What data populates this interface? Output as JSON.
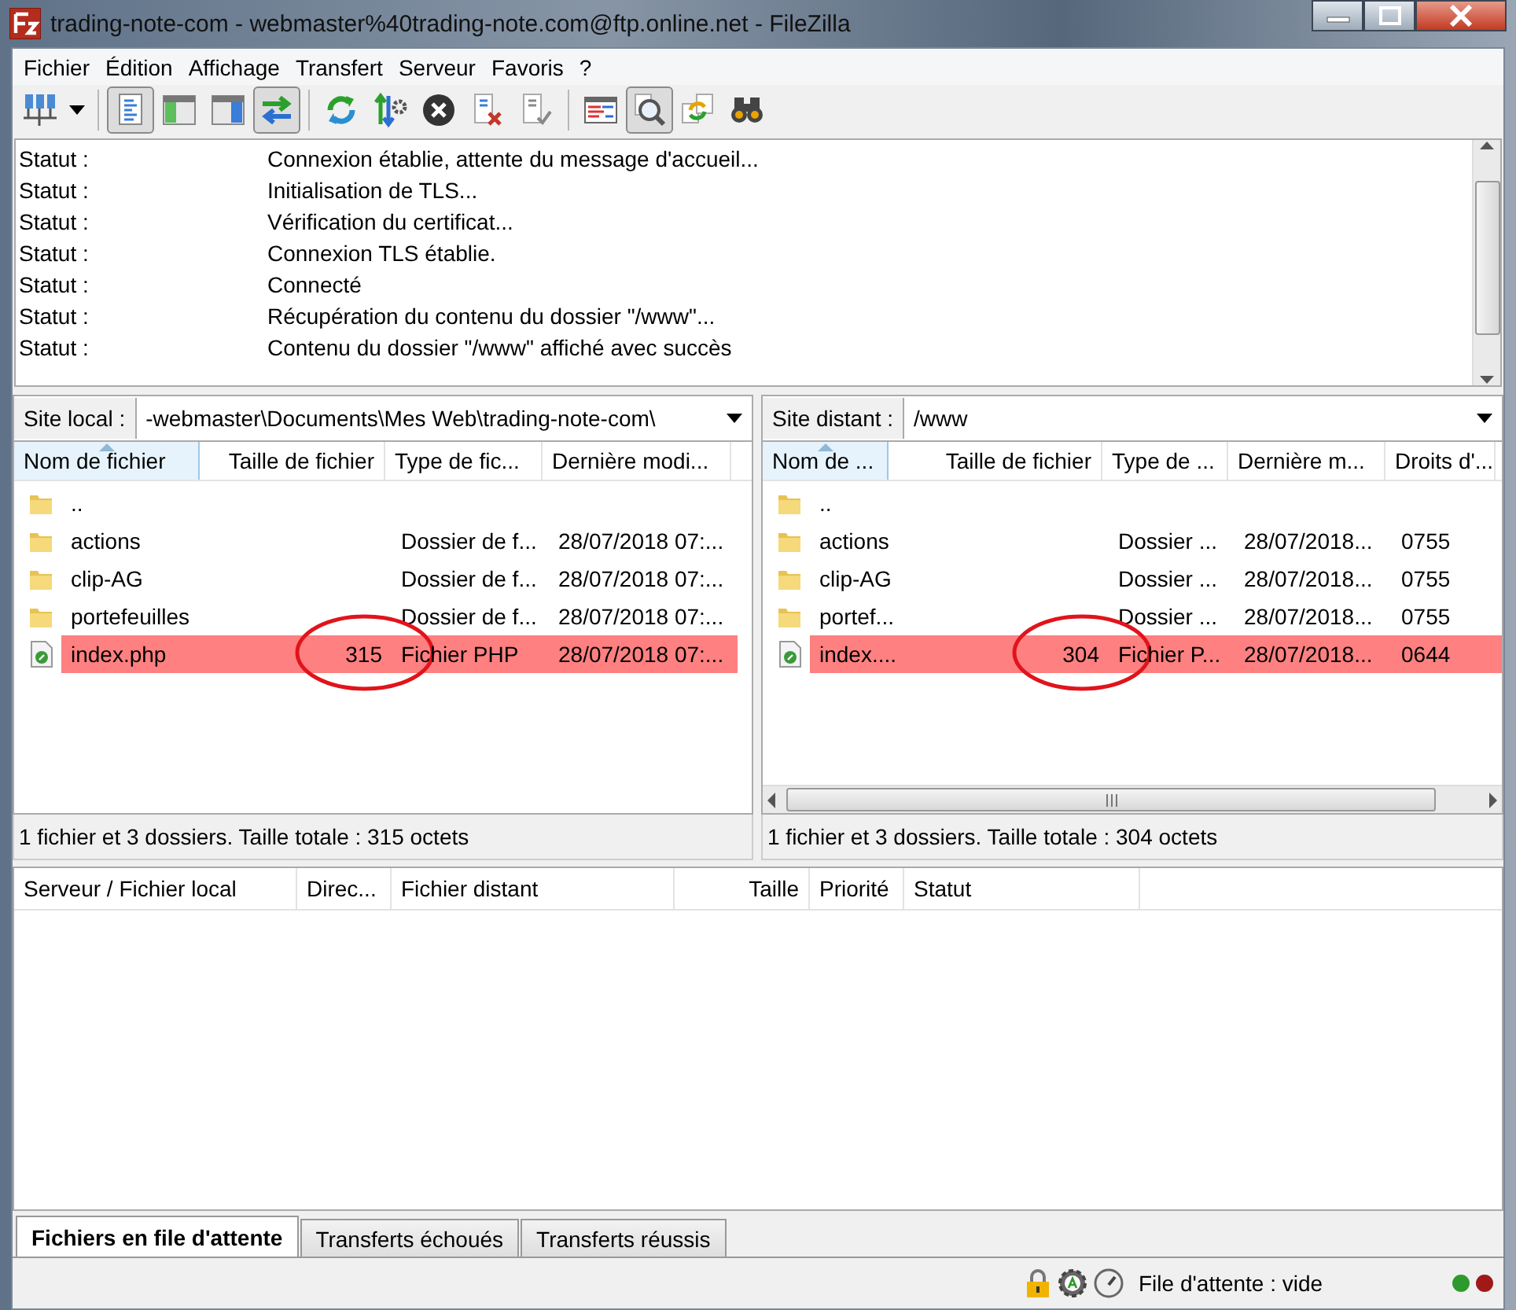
{
  "window": {
    "title": "trading-note-com - webmaster%40trading-note.com@ftp.online.net - FileZilla"
  },
  "menu": [
    "Fichier",
    "Édition",
    "Affichage",
    "Transfert",
    "Serveur",
    "Favoris",
    "?"
  ],
  "toolbar": [
    {
      "buttons": [
        {
          "kind": "servers",
          "pressed": false
        },
        {
          "kind": "caret",
          "pressed": false
        }
      ]
    },
    {
      "buttons": [
        {
          "kind": "document",
          "pressed": true
        },
        {
          "kind": "window-green",
          "pressed": false
        },
        {
          "kind": "window-blue",
          "pressed": false
        },
        {
          "kind": "arrows",
          "pressed": true
        }
      ]
    },
    {
      "buttons": [
        {
          "kind": "refresh",
          "pressed": false
        },
        {
          "kind": "updown-gear",
          "pressed": false
        },
        {
          "kind": "cancel",
          "pressed": false
        },
        {
          "kind": "file-x",
          "pressed": false
        },
        {
          "kind": "file-check",
          "pressed": false
        }
      ]
    },
    {
      "buttons": [
        {
          "kind": "table",
          "pressed": false
        },
        {
          "kind": "magnifier",
          "pressed": true
        },
        {
          "kind": "sync",
          "pressed": false
        },
        {
          "kind": "binoculars",
          "pressed": false
        }
      ]
    }
  ],
  "log": [
    {
      "label": "Statut :",
      "message": "Connexion établie, attente du message d'accueil..."
    },
    {
      "label": "Statut :",
      "message": "Initialisation de TLS..."
    },
    {
      "label": "Statut :",
      "message": "Vérification du certificat..."
    },
    {
      "label": "Statut :",
      "message": "Connexion TLS établie."
    },
    {
      "label": "Statut :",
      "message": "Connecté"
    },
    {
      "label": "Statut :",
      "message": "Récupération du contenu du dossier \"/www\"..."
    },
    {
      "label": "Statut :",
      "message": "Contenu du dossier \"/www\" affiché avec succès"
    }
  ],
  "panes": [
    {
      "label": "Site local :",
      "path": "-webmaster\\Documents\\Mes Web\\trading-note-com\\",
      "columns": [
        {
          "label": "Nom de fichier",
          "sorted": true
        },
        {
          "label": "Taille de fichier",
          "sorted": false
        },
        {
          "label": "Type de fic...",
          "sorted": false
        },
        {
          "label": "Dernière modi...",
          "sorted": false
        }
      ],
      "rows": [
        {
          "kind": "folder",
          "highlighted": false,
          "circled": false,
          "cells": [
            ".."
          ]
        },
        {
          "kind": "folder",
          "highlighted": false,
          "circled": false,
          "cells": [
            "actions",
            "",
            "Dossier de f...",
            "28/07/2018 07:..."
          ]
        },
        {
          "kind": "folder",
          "highlighted": false,
          "circled": false,
          "cells": [
            "clip-AG",
            "",
            "Dossier de f...",
            "28/07/2018 07:..."
          ]
        },
        {
          "kind": "folder",
          "highlighted": false,
          "circled": false,
          "cells": [
            "portefeuilles",
            "",
            "Dossier de f...",
            "28/07/2018 07:..."
          ]
        },
        {
          "kind": "php",
          "highlighted": true,
          "circled": true,
          "cells": [
            "index.php",
            "315",
            "Fichier PHP",
            "28/07/2018 07:..."
          ]
        }
      ],
      "hscroll": false,
      "summary": "1 fichier et 3 dossiers. Taille totale : 315 octets"
    },
    {
      "label": "Site distant :",
      "path": "/www",
      "columns": [
        {
          "label": "Nom de ...",
          "sorted": true
        },
        {
          "label": "Taille de fichier",
          "sorted": false
        },
        {
          "label": "Type de ...",
          "sorted": false
        },
        {
          "label": "Dernière m...",
          "sorted": false
        },
        {
          "label": "Droits d'...",
          "sorted": false
        }
      ],
      "rows": [
        {
          "kind": "folder",
          "highlighted": false,
          "circled": false,
          "cells": [
            ".."
          ]
        },
        {
          "kind": "folder",
          "highlighted": false,
          "circled": false,
          "cells": [
            "actions",
            "",
            "Dossier ...",
            "28/07/2018...",
            "0755"
          ]
        },
        {
          "kind": "folder",
          "highlighted": false,
          "circled": false,
          "cells": [
            "clip-AG",
            "",
            "Dossier ...",
            "28/07/2018...",
            "0755"
          ]
        },
        {
          "kind": "folder",
          "highlighted": false,
          "circled": false,
          "cells": [
            "portef...",
            "",
            "Dossier ...",
            "28/07/2018...",
            "0755"
          ]
        },
        {
          "kind": "php",
          "highlighted": true,
          "circled": true,
          "cells": [
            "index....",
            "304",
            "Fichier P...",
            "28/07/2018...",
            "0644"
          ]
        }
      ],
      "hscroll": true,
      "summary": "1 fichier et 3 dossiers. Taille totale : 304 octets"
    }
  ],
  "queue": {
    "columns": [
      "Serveur / Fichier local",
      "Direc...",
      "Fichier distant",
      "Taille",
      "Priorité",
      "Statut"
    ]
  },
  "tabs": [
    {
      "label": "Fichiers en file d'attente",
      "selected": true
    },
    {
      "label": "Transferts échoués",
      "selected": false
    },
    {
      "label": "Transferts réussis",
      "selected": false
    }
  ],
  "status_bar": {
    "queue": "File d'attente : vide"
  }
}
